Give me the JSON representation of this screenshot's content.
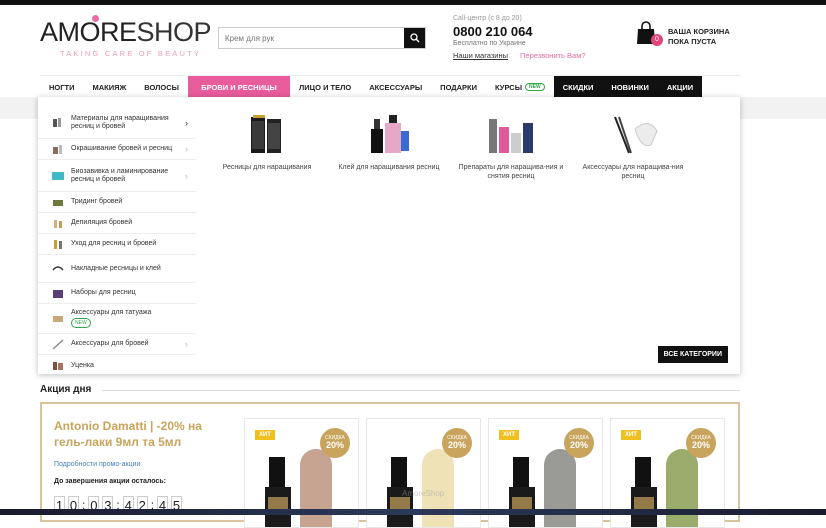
{
  "header": {
    "logo_main": "AMORE",
    "logo_shop": "SHOP",
    "logo_tagline": "TAKING CARE OF BEAUTY",
    "search_placeholder": "Крем для рук",
    "call_label": "Call-центр (с 8 до 20)",
    "phone": "0800 210 064",
    "free": "Бесплатно по Украине",
    "link_stores": "Наши магазины",
    "link_callback": "Перезвонить Вам?",
    "cart_count": "0",
    "cart_line1": "ВАША КОРЗИНА",
    "cart_line2": "ПОКА ПУСТА"
  },
  "nav": {
    "items": [
      {
        "label": "НОГТИ"
      },
      {
        "label": "МАКИЯЖ"
      },
      {
        "label": "ВОЛОСЫ"
      },
      {
        "label": "БРОВИ И РЕСНИЦЫ"
      },
      {
        "label": "ЛИЦО И ТЕЛО"
      },
      {
        "label": "АКСЕССУАРЫ"
      },
      {
        "label": "ПОДАРКИ"
      },
      {
        "label": "КУРСЫ",
        "badge": "NEW"
      },
      {
        "label": "СКИДКИ"
      },
      {
        "label": "НОВИНКИ"
      },
      {
        "label": "АКЦИИ"
      }
    ]
  },
  "menu": {
    "side": [
      {
        "label": "Материалы для наращивания ресниц и бровей"
      },
      {
        "label": "Окрашивание бровей и ресниц"
      },
      {
        "label": "Биозавивка и ламинирование ресниц и бровей"
      },
      {
        "label": "Тридинг бровей"
      },
      {
        "label": "Депиляция бровей"
      },
      {
        "label": "Уход для ресниц и бровей"
      },
      {
        "label": "Накладные ресницы и клей"
      },
      {
        "label": "Наборы для ресниц"
      },
      {
        "label": "Аксессуары для татуажа",
        "badge": "NEW"
      },
      {
        "label": "Аксессуары для бровей"
      },
      {
        "label": "Уценка"
      }
    ],
    "categories": [
      {
        "label": "Ресницы для наращивания"
      },
      {
        "label": "Клей для наращивания ресниц"
      },
      {
        "label": "Препараты для наращива-ния и снятия ресниц"
      },
      {
        "label": "Аксессуары для наращива-ния ресниц"
      }
    ],
    "all_categories": "ВСЕ КАТЕГОРИИ"
  },
  "promo": {
    "section_title": "Акция дня",
    "title": "Antonio Damatti | -20% на гель-лаки 9мл та 5мл",
    "details_link": "Подробности промо-акции",
    "ends_label": "До завершения акции осталось:",
    "timer": [
      "1",
      "0",
      "0",
      "3",
      "4",
      "2",
      "4",
      "5"
    ],
    "products": [
      {
        "badge": "ХИТ",
        "disc_label": "СКИДКА",
        "disc_value": "20%",
        "color": "#c7a392"
      },
      {
        "badge": "",
        "disc_label": "СКИДКА",
        "disc_value": "20%",
        "color": "#efe2b6"
      },
      {
        "badge": "ХИТ",
        "disc_label": "СКИДКА",
        "disc_value": "20%",
        "color": "#9a9a96"
      },
      {
        "badge": "ХИТ",
        "disc_label": "СКИДКА",
        "disc_value": "20%",
        "color": "#9bab6c"
      }
    ],
    "watermark": "AmoreShop"
  },
  "colors": {
    "accent_pink": "#e85c9c",
    "gold": "#c8a45c",
    "dark": "#111111"
  }
}
